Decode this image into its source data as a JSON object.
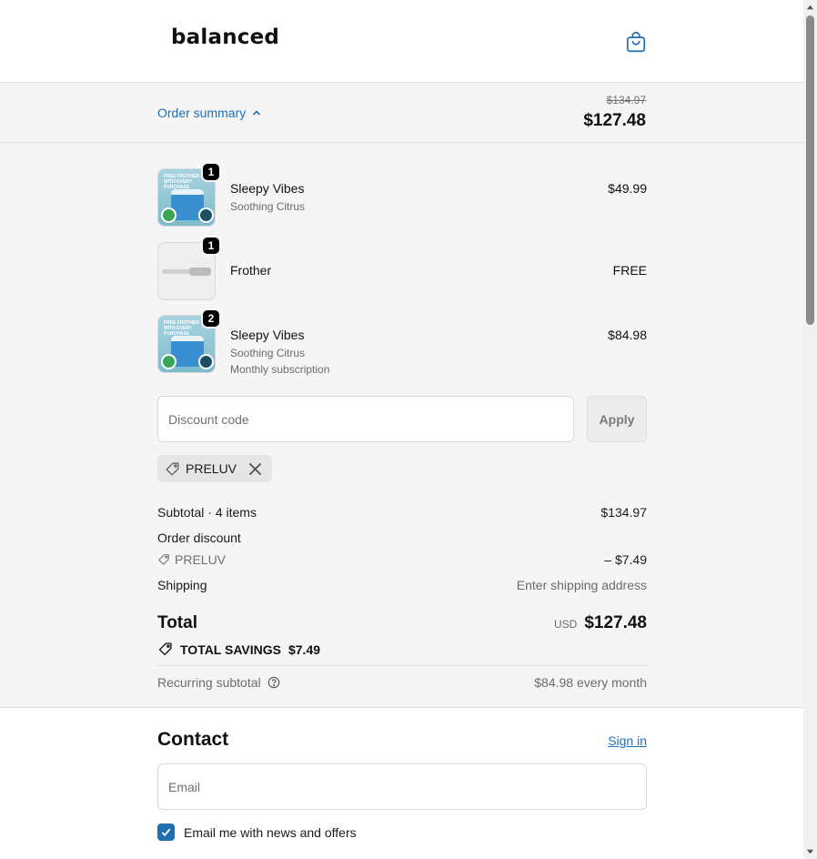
{
  "header": {
    "logo_text": "balanced",
    "cart_icon": "shopping-bag-icon"
  },
  "summary_bar": {
    "toggle_label": "Order summary",
    "original_price": "$134.97",
    "total": "$127.48"
  },
  "items": [
    {
      "name": "Sleepy Vibes",
      "variant": "Soothing Citrus",
      "plan": "",
      "price": "$49.99",
      "quantity": "1",
      "thumb_text": "FREE FROTHER WITH EVERY PURCHASE"
    },
    {
      "name": "Frother",
      "variant": "",
      "plan": "",
      "price": "FREE",
      "quantity": "1"
    },
    {
      "name": "Sleepy Vibes",
      "variant": "Soothing Citrus",
      "plan": "Monthly subscription",
      "price": "$84.98",
      "quantity": "2",
      "thumb_text": "FREE FROTHER WITH EVERY PURCHASE"
    }
  ],
  "discount": {
    "placeholder": "Discount code",
    "apply_label": "Apply",
    "applied_code": "PRELUV"
  },
  "totals": {
    "subtotal_label": "Subtotal · 4 items",
    "subtotal_value": "$134.97",
    "order_discount_label": "Order discount",
    "discount_code": "PRELUV",
    "discount_value": "– $7.49",
    "shipping_label": "Shipping",
    "shipping_value": "Enter shipping address",
    "total_label": "Total",
    "currency": "USD",
    "total_value": "$127.48",
    "savings_label": "TOTAL SAVINGS",
    "savings_value": "$7.49",
    "recurring_label": "Recurring subtotal",
    "recurring_value": "$84.98 every month"
  },
  "contact": {
    "title": "Contact",
    "sign_in_label": "Sign in",
    "email_placeholder": "Email",
    "newsletter_label": "Email me with news and offers",
    "newsletter_checked": true
  },
  "colors": {
    "accent": "#1f6fb5",
    "panel_bg": "#f5f5f5"
  }
}
